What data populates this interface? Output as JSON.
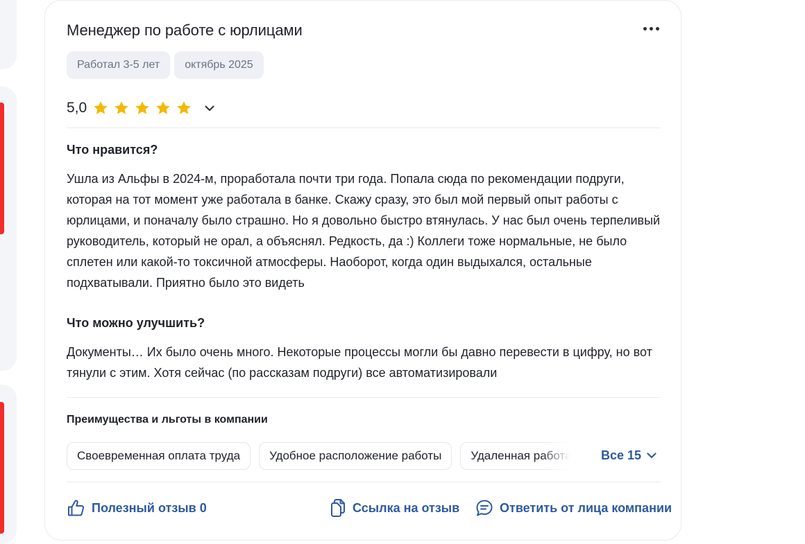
{
  "review": {
    "title": "Менеджер по работе с юрлицами",
    "tags": [
      "Работал 3-5 лет",
      "октябрь 2025"
    ],
    "rating": "5,0",
    "stars": 5,
    "star_color": "#f5b800",
    "likes_title": "Что нравится?",
    "likes_text": "Ушла из Альфы в 2024-м, проработала почти три года. Попала сюда по рекомендации подруги, которая на тот момент уже работала в банке. Скажу сразу, это был мой первый опыт работы с юрлицами, и поначалу было страшно. Но я довольно быстро втянулась. У нас был очень терпеливый руководитель, который не орал, а объяснял. Редкость, да :) Коллеги тоже нормальные, не было сплетен или какой-то токсичной атмосферы. Наоборот, когда один выдыхался, остальные подхватывали. Приятно было это видеть",
    "improve_title": "Что можно улучшить?",
    "improve_text": "Документы… Их было очень много. Некоторые процессы могли бы давно перевести в цифру, но вот тянули с этим. Хотя сейчас (по рассказам подруги) все автоматизировали",
    "benefits_title": "Преимущества и льготы в компании",
    "benefits": [
      "Своевременная оплата труда",
      "Удобное расположение работы",
      "Удаленная работа"
    ],
    "all_benefits_label": "Все 15",
    "helpful_label": "Полезный отзыв 0",
    "link_label": "Ссылка на отзыв",
    "reply_label": "Ответить от лица компании",
    "accent_color": "#2d5aa0"
  }
}
